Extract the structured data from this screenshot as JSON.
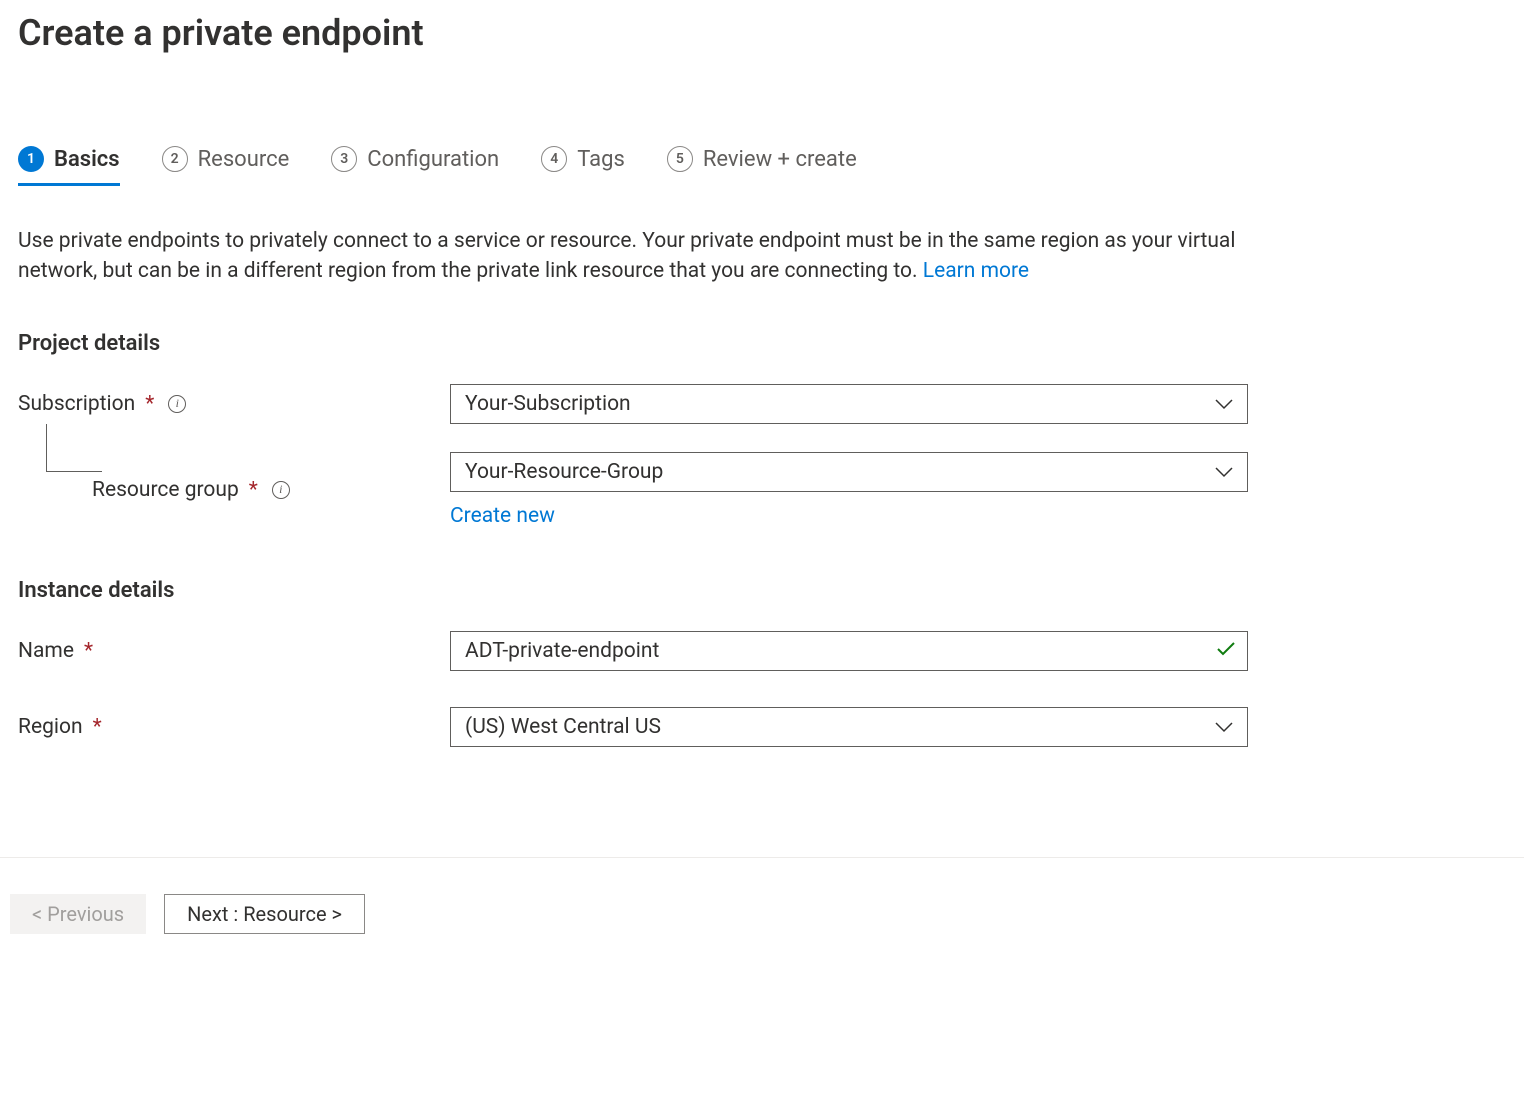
{
  "header": {
    "title": "Create a private endpoint"
  },
  "tabs": [
    {
      "number": "1",
      "label": "Basics",
      "active": true
    },
    {
      "number": "2",
      "label": "Resource",
      "active": false
    },
    {
      "number": "3",
      "label": "Configuration",
      "active": false
    },
    {
      "number": "4",
      "label": "Tags",
      "active": false
    },
    {
      "number": "5",
      "label": "Review + create",
      "active": false
    }
  ],
  "description": {
    "text": "Use private endpoints to privately connect to a service or resource. Your private endpoint must be in the same region as your virtual network, but can be in a different region from the private link resource that you are connecting to.  ",
    "learn_more": "Learn more"
  },
  "sections": {
    "project_details": {
      "title": "Project details",
      "subscription": {
        "label": "Subscription",
        "value": "Your-Subscription"
      },
      "resource_group": {
        "label": "Resource group",
        "value": "Your-Resource-Group",
        "create_new": "Create new"
      }
    },
    "instance_details": {
      "title": "Instance details",
      "name": {
        "label": "Name",
        "value": "ADT-private-endpoint"
      },
      "region": {
        "label": "Region",
        "value": "(US) West Central US"
      }
    }
  },
  "footer": {
    "previous": "< Previous",
    "next": "Next : Resource >"
  }
}
